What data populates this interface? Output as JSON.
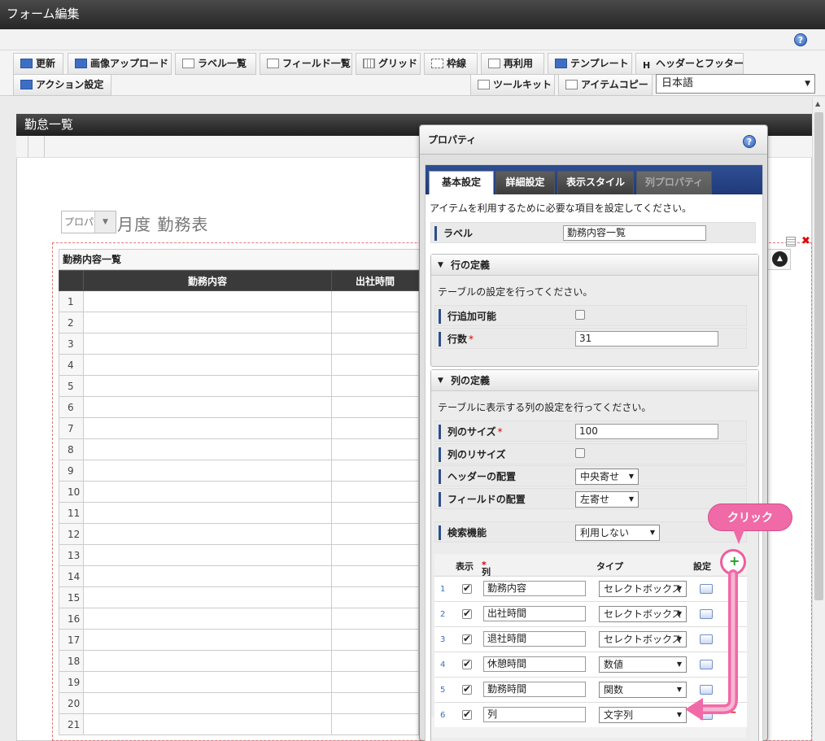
{
  "window": {
    "title": "フォーム編集"
  },
  "toolbar": {
    "row1": [
      {
        "label": "更新",
        "icon": "pencil-icon"
      },
      {
        "label": "画像アップロード",
        "icon": "image-upload-icon"
      },
      {
        "label": "ラベル一覧",
        "icon": "label-list-icon"
      },
      {
        "label": "フィールド一覧",
        "icon": "field-list-icon"
      },
      {
        "label": "グリッド",
        "icon": "grid-icon"
      },
      {
        "label": "枠線",
        "icon": "border-icon"
      },
      {
        "label": "再利用",
        "icon": "reuse-icon"
      },
      {
        "label": "テンプレート",
        "icon": "template-icon"
      },
      {
        "label": "ヘッダーとフッター",
        "icon": "header-footer-icon"
      }
    ],
    "row2_left": [
      {
        "label": "アクション設定",
        "icon": "action-icon"
      }
    ],
    "row2_right": [
      {
        "label": "ツールキット",
        "icon": "toolkit-icon"
      },
      {
        "label": "アイテムコピー",
        "icon": "item-copy-icon"
      }
    ],
    "language": "日本語"
  },
  "canvas": {
    "title": "勤怠一覧",
    "month_select": "プロパ",
    "month_title": "月度 勤務表",
    "table_caption": "勤務内容一覧",
    "table_headers": [
      "勤務内容",
      "出社時間"
    ],
    "row_numbers": [
      "1",
      "2",
      "3",
      "4",
      "5",
      "6",
      "7",
      "8",
      "9",
      "10",
      "11",
      "12",
      "13",
      "14",
      "15",
      "16",
      "17",
      "18",
      "19",
      "20",
      "21"
    ]
  },
  "dialog": {
    "title": "プロパティ",
    "tabs": [
      {
        "label": "基本設定",
        "state": "active"
      },
      {
        "label": "詳細設定",
        "state": "normal"
      },
      {
        "label": "表示スタイル",
        "state": "normal"
      },
      {
        "label": "列プロパティ",
        "state": "disabled"
      }
    ],
    "intro": "アイテムを利用するために必要な項目を設定してください。",
    "label_field": {
      "label": "ラベル",
      "value": "勤務内容一覧"
    },
    "row_section": {
      "title": "行の定義",
      "desc": "テーブルの設定を行ってください。",
      "can_add_label": "行追加可能",
      "can_add_checked": false,
      "rows_label": "行数",
      "rows_value": "31"
    },
    "col_section": {
      "title": "列の定義",
      "desc": "テーブルに表示する列の設定を行ってください。",
      "size_label": "列のサイズ",
      "size_value": "100",
      "resize_label": "列のリサイズ",
      "resize_checked": false,
      "header_align_label": "ヘッダーの配置",
      "header_align_value": "中央寄せ",
      "field_align_label": "フィールドの配置",
      "field_align_value": "左寄せ",
      "search_label": "検索機能",
      "search_value": "利用しない",
      "table_headers": {
        "show": "表示",
        "name": "列名",
        "type": "タイプ",
        "settings": "設定"
      },
      "columns": [
        {
          "no": "1",
          "show": true,
          "name": "勤務内容",
          "type": "セレクトボックス"
        },
        {
          "no": "2",
          "show": true,
          "name": "出社時間",
          "type": "セレクトボックス"
        },
        {
          "no": "3",
          "show": true,
          "name": "退社時間",
          "type": "セレクトボックス"
        },
        {
          "no": "4",
          "show": true,
          "name": "休憩時間",
          "type": "数値"
        },
        {
          "no": "5",
          "show": true,
          "name": "勤務時間",
          "type": "関数"
        },
        {
          "no": "6",
          "show": true,
          "name": "列",
          "type": "文字列"
        }
      ]
    }
  },
  "annotation": {
    "callout": "クリック",
    "color": "#ef6aa6"
  },
  "colors": {
    "tab_bar": "#2f4f93",
    "title_bar": "#262626",
    "required": "#dd0000",
    "add_icon": "#2b9a2b"
  }
}
